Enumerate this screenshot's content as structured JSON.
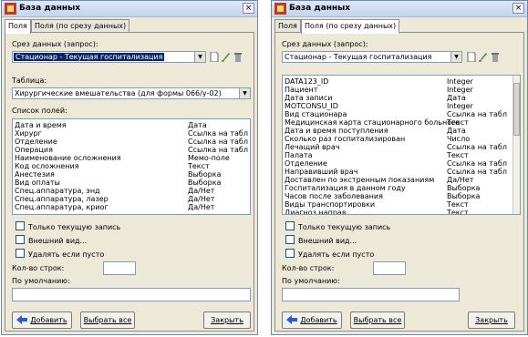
{
  "windows": [
    {
      "title": "База данных",
      "close": "×",
      "tabs": [
        "Поля",
        "Поля (по срезу данных)"
      ],
      "active_tab": 0,
      "slice_label": "Срез данных (запрос):",
      "slice_value": "Стационар - Текущая госпитализация",
      "table_label": "Таблица:",
      "table_value": "Хирургические вмешательства (для формы 066/у-02)",
      "fields_label": "Список полей:",
      "fields": [
        {
          "name": "Дата и время",
          "type": "Дата"
        },
        {
          "name": "Хирург",
          "type": "Ссылка на табл"
        },
        {
          "name": "Отделение",
          "type": "Ссылка на табл"
        },
        {
          "name": "Операция",
          "type": "Ссылка на табл"
        },
        {
          "name": "Наименование осложнения",
          "type": "Мемо-поле"
        },
        {
          "name": "Код осложнения",
          "type": "Текст"
        },
        {
          "name": "Анестезия",
          "type": "Выборка"
        },
        {
          "name": "Вид оплаты",
          "type": "Выборка"
        },
        {
          "name": "Спец.аппаратура, энд",
          "type": "Да/Нет"
        },
        {
          "name": "Спец.аппаратура, лазер",
          "type": "Да/Нет"
        },
        {
          "name": "Спец.аппаратура, криог",
          "type": "Да/Нет"
        }
      ],
      "checks": [
        "Только текущую запись",
        "Внешний вид...",
        "Удалять если пусто"
      ],
      "rows_label": "Кол-во строк:",
      "default_label": "По умолчанию:",
      "btn_add": "Добавить",
      "btn_select_all": "Выбрать все",
      "btn_close": "Закрыть"
    },
    {
      "title": "База данных",
      "close": "×",
      "tabs": [
        "Поля",
        "Поля (по срезу данных)"
      ],
      "active_tab": 1,
      "slice_label": "Срез данных (запрос):",
      "slice_value": "Стационар - Текущая госпитализация",
      "fields": [
        {
          "name": "DATA123_ID",
          "type": "Integer"
        },
        {
          "name": "Пациент",
          "type": "Integer"
        },
        {
          "name": "Дата записи",
          "type": "Дата"
        },
        {
          "name": "MOTCONSU_ID",
          "type": "Integer"
        },
        {
          "name": "Вид стационара",
          "type": "Ссылка на табл"
        },
        {
          "name": "Медицинская карта стационарного больного",
          "type": "Текст"
        },
        {
          "name": "Дата и время поступления",
          "type": "Дата"
        },
        {
          "name": "Сколько раз госпитализирован",
          "type": "Число"
        },
        {
          "name": "Лечащий врач",
          "type": "Ссылка на табл"
        },
        {
          "name": "Палата",
          "type": "Текст"
        },
        {
          "name": "Отделение",
          "type": "Ссылка на табл"
        },
        {
          "name": "Направивший врач",
          "type": "Ссылка на табл"
        },
        {
          "name": "Доставлен по экстренным показаниям",
          "type": "Да/Нет"
        },
        {
          "name": "Госпитализация в данном году",
          "type": "Выборка"
        },
        {
          "name": "Часов после заболевания",
          "type": "Выборка"
        },
        {
          "name": "Виды транспортировки",
          "type": "Текст"
        },
        {
          "name": "Диагноз направ...",
          "type": "Текст"
        }
      ],
      "checks": [
        "Только текущую запись",
        "Внешний вид...",
        "Удалять если пусто"
      ],
      "rows_label": "Кол-во строк:",
      "default_label": "По умолчанию:",
      "btn_add": "Добавить",
      "btn_select_all": "Выбрать все",
      "btn_close": "Закрыть"
    }
  ],
  "icons": {
    "app": "database-app-icon",
    "new": "new-document-icon",
    "edit": "edit-pencil-icon",
    "delete": "trash-icon",
    "add_arrow": "left-arrow-icon"
  },
  "colors": {
    "selection": "#0a246a",
    "window_bg": "#ece9d8",
    "accent_arrow": "#2a5bd7"
  }
}
